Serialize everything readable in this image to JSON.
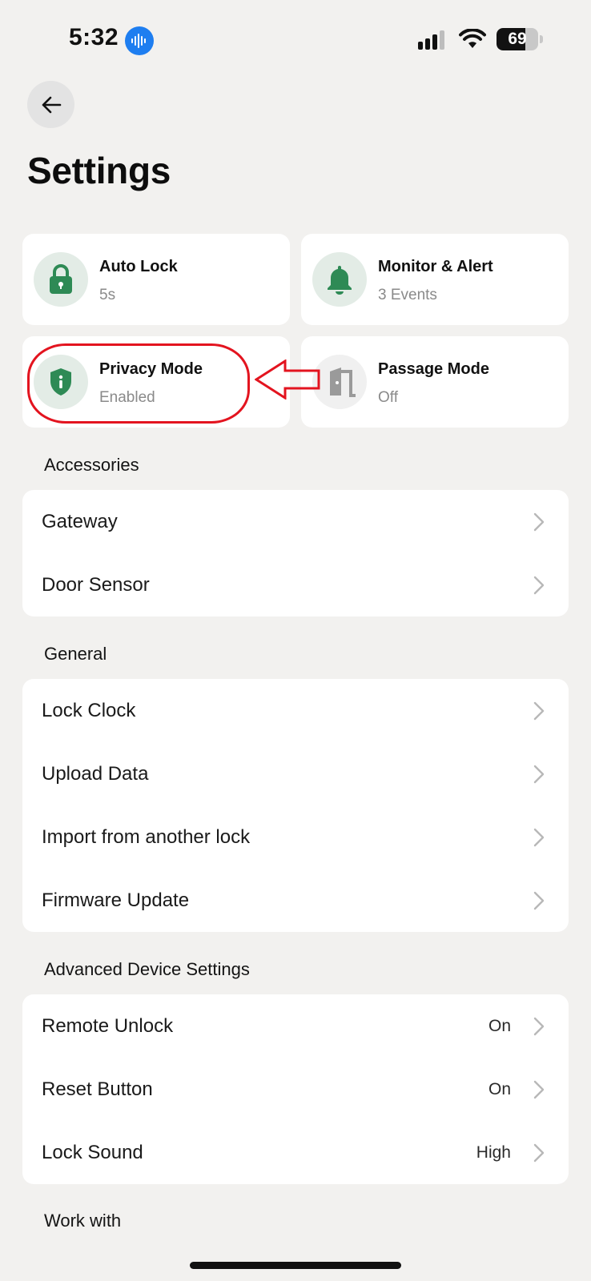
{
  "status_bar": {
    "time": "5:32",
    "battery": "69",
    "battery_level": 0.69
  },
  "header": {
    "back_icon": "arrow-left-icon",
    "title": "Settings"
  },
  "tiles": [
    {
      "title": "Auto Lock",
      "subtitle": "5s",
      "icon": "lock-icon"
    },
    {
      "title": "Monitor & Alert",
      "subtitle": "3 Events",
      "icon": "bell-icon"
    },
    {
      "title": "Privacy Mode",
      "subtitle": "Enabled",
      "icon": "shield-info-icon"
    },
    {
      "title": "Passage Mode",
      "subtitle": "Off",
      "icon": "door-icon"
    }
  ],
  "sections": {
    "accessories": {
      "label": "Accessories",
      "items": [
        {
          "label": "Gateway"
        },
        {
          "label": "Door Sensor"
        }
      ]
    },
    "general": {
      "label": "General",
      "items": [
        {
          "label": "Lock Clock"
        },
        {
          "label": "Upload Data"
        },
        {
          "label": "Import from another lock"
        },
        {
          "label": "Firmware Update"
        }
      ]
    },
    "advanced": {
      "label": "Advanced Device Settings",
      "items": [
        {
          "label": "Remote Unlock",
          "value": "On"
        },
        {
          "label": "Reset Button",
          "value": "On"
        },
        {
          "label": "Lock Sound",
          "value": "High"
        }
      ]
    },
    "work_with": {
      "label": "Work with"
    }
  },
  "colors": {
    "background": "#f2f1ef",
    "accent_green": "#2e8a55",
    "annotation_red": "#e3141f",
    "voice_blue": "#1e7ef0"
  }
}
